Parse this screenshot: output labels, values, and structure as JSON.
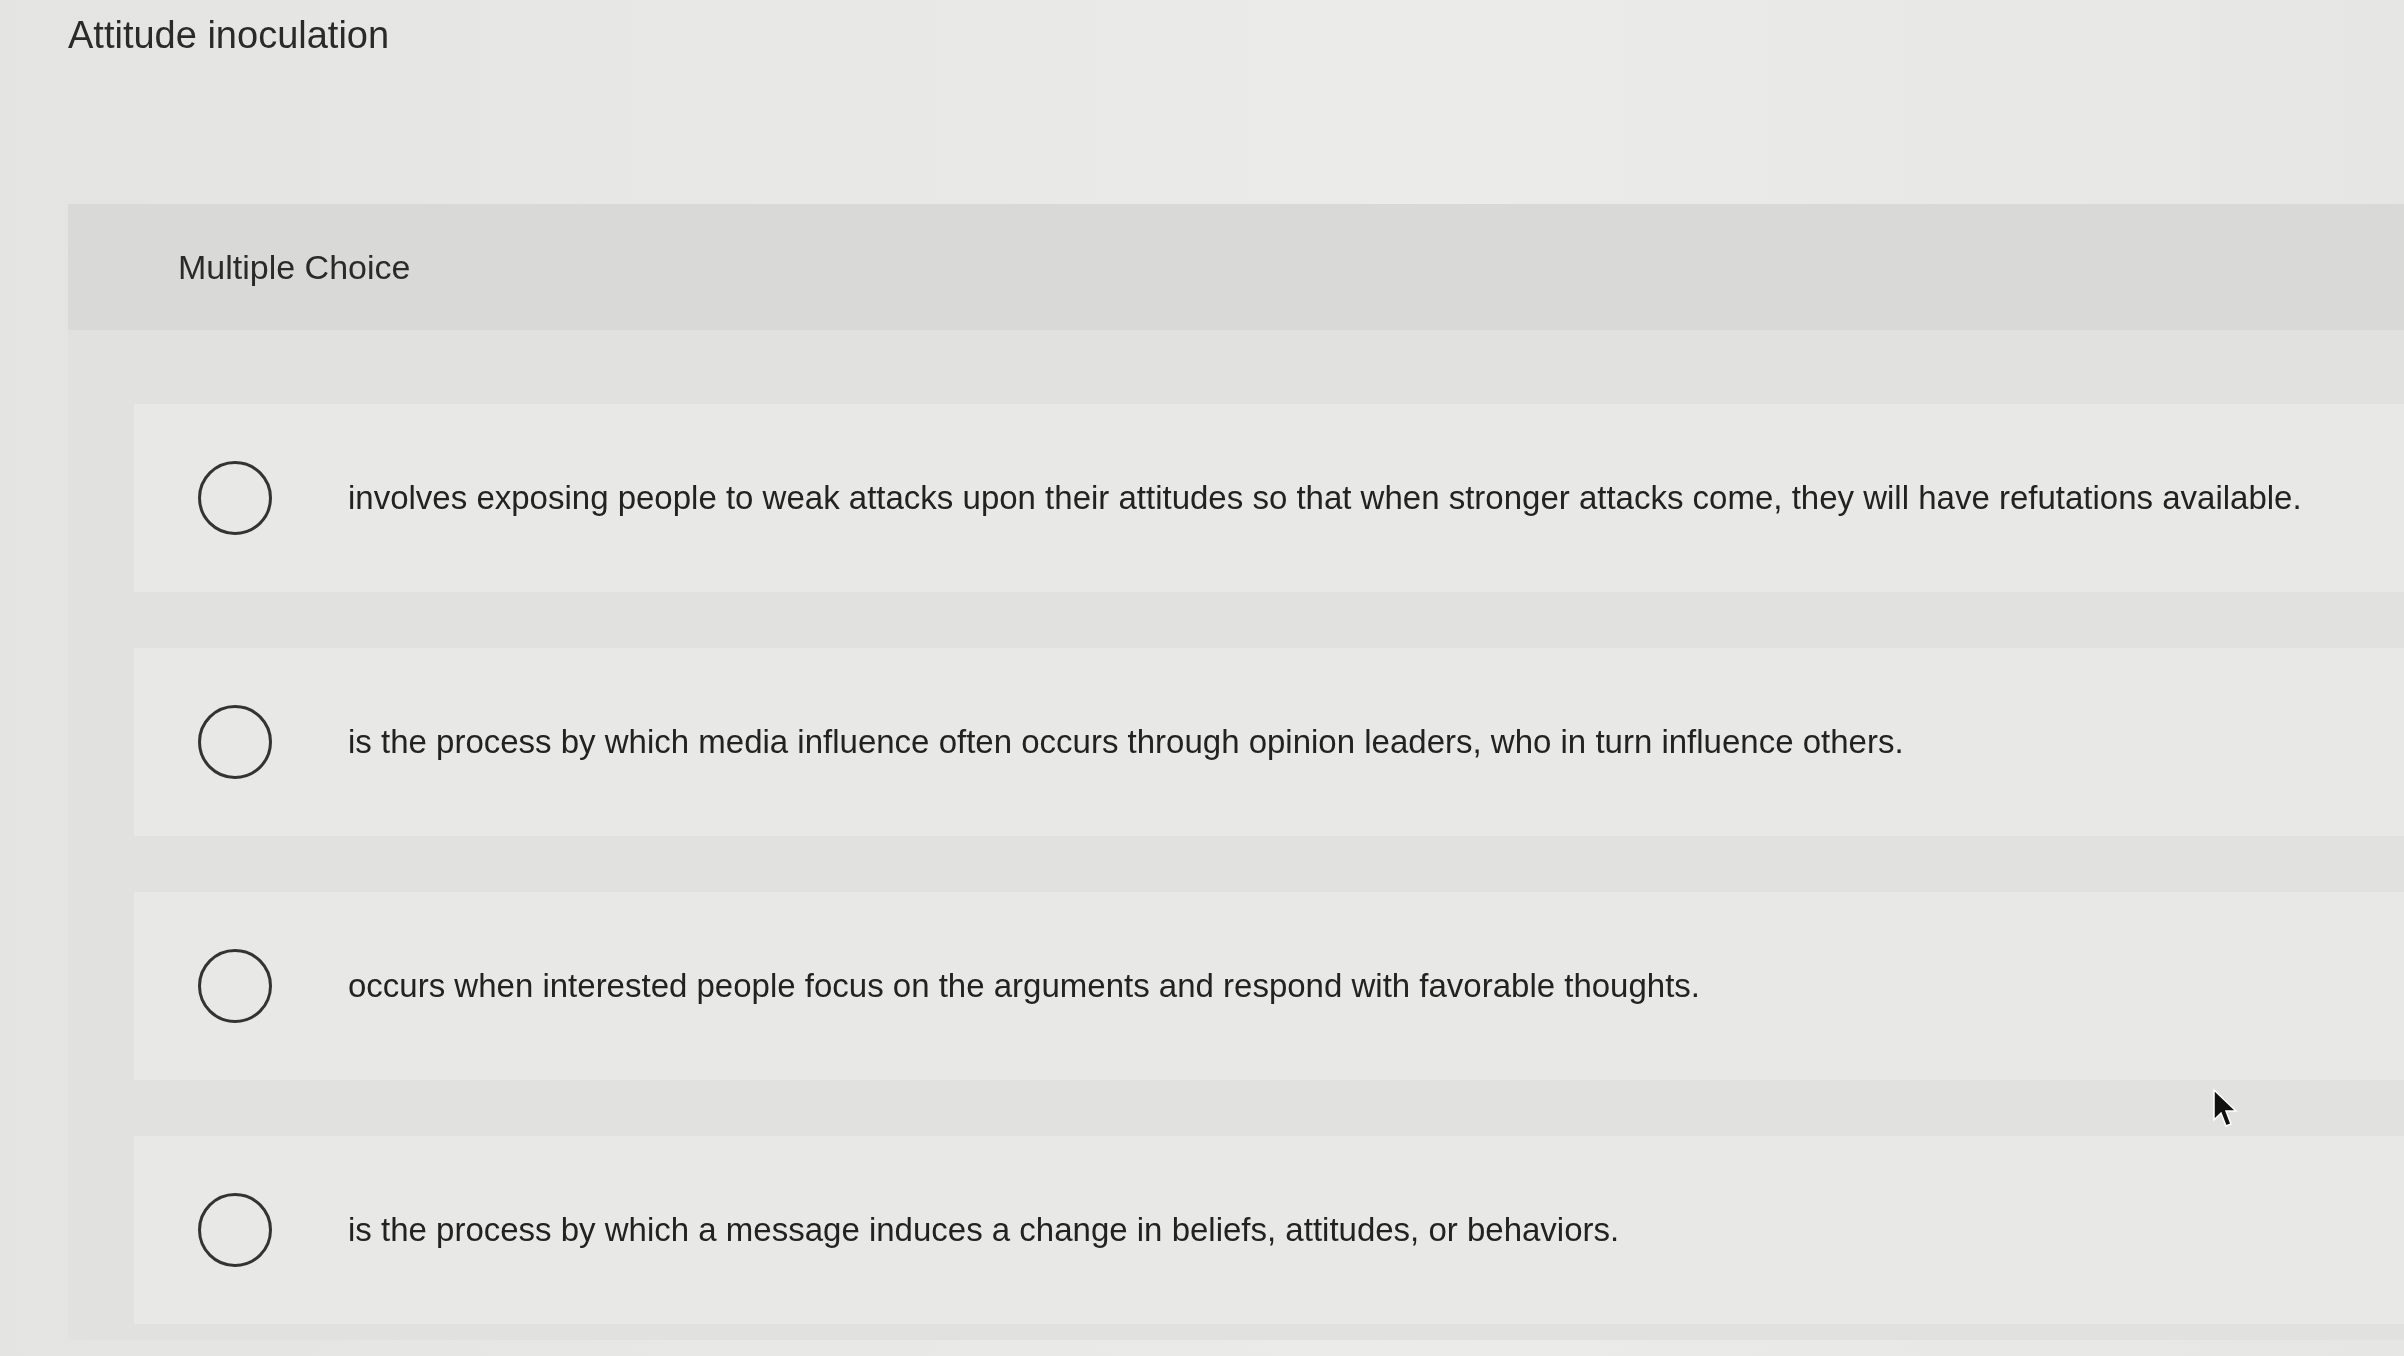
{
  "title": "Attitude inoculation",
  "question_type": "Multiple Choice",
  "options": [
    {
      "text": "involves exposing people to weak attacks upon their attitudes so that when stronger attacks come, they will have refutations available.",
      "selected": false
    },
    {
      "text": "is the process by which media influence often occurs through opinion leaders, who in turn influence others.",
      "selected": false
    },
    {
      "text": "occurs when interested people focus on the arguments and respond with favorable thoughts.",
      "selected": false
    },
    {
      "text": "is the process by which a message induces a change in beliefs, attitudes, or behaviors.",
      "selected": false
    }
  ]
}
